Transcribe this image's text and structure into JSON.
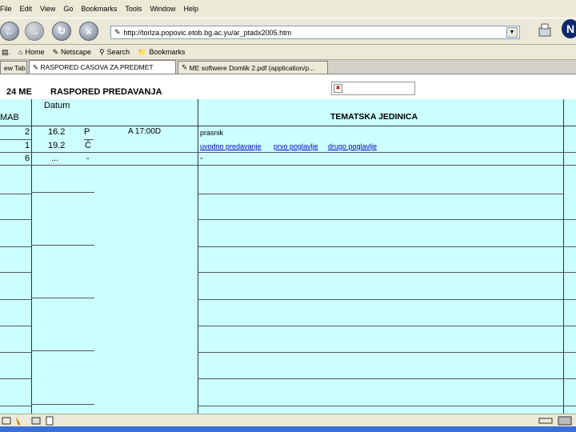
{
  "menu": [
    "File",
    "Edit",
    "View",
    "Go",
    "Bookmarks",
    "Tools",
    "Window",
    "Help"
  ],
  "address": {
    "url": "http://torlza.popovic.etob.bg.ac.yu/ar_ptadx2005.htm"
  },
  "bookmarks_bar": {
    "home": "Home",
    "netscape": "Netscape",
    "search": "Search",
    "bookmarks": "Bookmarks"
  },
  "tabs": [
    {
      "label": "ew Tab"
    },
    {
      "label": "RASPORED CASOVA ZA PREDMET"
    },
    {
      "label": "ME softwere Domlik 2.pdf (application/p..."
    }
  ],
  "page": {
    "code": "24 ME",
    "title": "RASPORED PREDAVANJA",
    "headers": {
      "col1": "MAB",
      "col2": "Datum",
      "col4": "TEMATSKA JEDINICA"
    },
    "rows": [
      {
        "num": "2",
        "date": "16.2",
        "day": "P",
        "time": "A 17:00D",
        "topic": "prasnik"
      },
      {
        "num": "1",
        "date": "19.2",
        "day": "Č",
        "links": [
          "uvodno predavanje",
          "prvo poglavlje",
          "drugo poglavlje"
        ]
      },
      {
        "num": "6",
        "date": "...",
        "day": "-",
        "topic": "-"
      }
    ]
  },
  "colors": {
    "chrome": "#ece9d8",
    "table_bg": "#ccffff",
    "link": "#0000cc",
    "throbber": "#0e2a6b"
  }
}
